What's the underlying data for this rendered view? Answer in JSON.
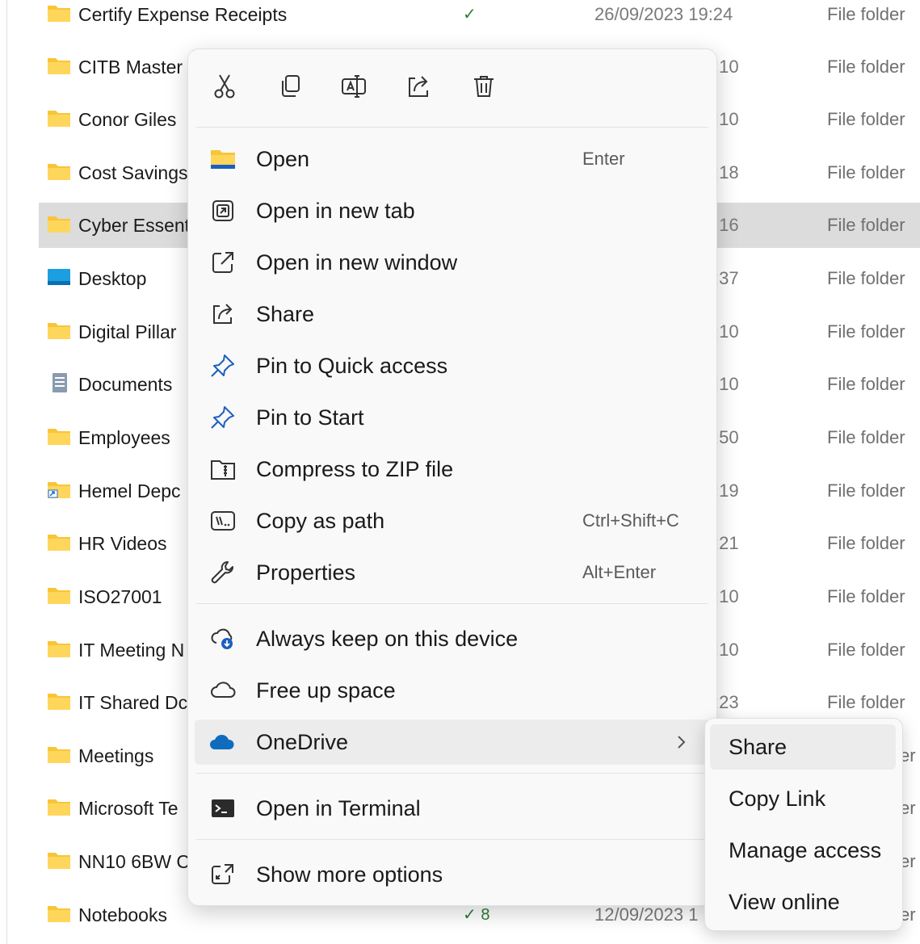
{
  "files": [
    {
      "name": "Certify Expense Receipts",
      "date": "26/09/2023 19:24",
      "type": "File folder",
      "icon": "folder-icon",
      "status": "synced-check"
    },
    {
      "name": "CITB Master",
      "time": ":10",
      "type": "File folder",
      "icon": "folder-icon"
    },
    {
      "name": "Conor Giles",
      "time": ":10",
      "type": "File folder",
      "icon": "folder-icon"
    },
    {
      "name": "Cost Savings",
      "time": ":18",
      "type": "File folder",
      "icon": "folder-icon"
    },
    {
      "name": "Cyber Essent",
      "time": ":16",
      "type": "File folder",
      "icon": "folder-icon",
      "selected": true
    },
    {
      "name": "Desktop",
      "time": ":37",
      "type": "File folder",
      "icon": "desktop-folder-icon"
    },
    {
      "name": "Digital Pillar",
      "time": ":10",
      "type": "File folder",
      "icon": "folder-icon"
    },
    {
      "name": "Documents",
      "time": ":10",
      "type": "File folder",
      "icon": "documents-folder-icon"
    },
    {
      "name": "Employees",
      "time": ":50",
      "type": "File folder",
      "icon": "folder-icon"
    },
    {
      "name": "Hemel Depc",
      "time": ":19",
      "type": "File folder",
      "icon": "shortcut-folder-icon"
    },
    {
      "name": "HR Videos",
      "time": ":21",
      "type": "File folder",
      "icon": "folder-icon"
    },
    {
      "name": "ISO27001",
      "time": ":10",
      "type": "File folder",
      "icon": "folder-icon"
    },
    {
      "name": "IT Meeting N",
      "time": ":10",
      "type": "File folder",
      "icon": "folder-icon"
    },
    {
      "name": "IT Shared Dc",
      "time": ":23",
      "type": "File folder",
      "icon": "folder-icon"
    },
    {
      "name": "Meetings",
      "typecut": "er",
      "icon": "folder-icon"
    },
    {
      "name": "Microsoft Te",
      "typecut": "er",
      "icon": "folder-icon"
    },
    {
      "name": "NN10 6BW C",
      "typecut": "er",
      "icon": "folder-icon"
    },
    {
      "name": "Notebooks",
      "date": "12/09/2023 1",
      "typecut": "er",
      "icon": "folder-icon",
      "status": "synced-shared"
    }
  ],
  "status_glyphs": {
    "synced-check": "✓",
    "synced-shared": "✓ 8"
  },
  "quick_actions": [
    {
      "name": "cut",
      "icon": "scissors-icon"
    },
    {
      "name": "copy",
      "icon": "copy-icon"
    },
    {
      "name": "rename",
      "icon": "rename-icon"
    },
    {
      "name": "share",
      "icon": "share-icon"
    },
    {
      "name": "delete",
      "icon": "trash-icon"
    }
  ],
  "menu": {
    "open": {
      "label": "Open",
      "shortcut": "Enter",
      "icon": "folder-open-icon"
    },
    "open_new_tab": {
      "label": "Open in new tab",
      "icon": "new-tab-icon"
    },
    "open_new_window": {
      "label": "Open in new window",
      "icon": "new-window-icon"
    },
    "share": {
      "label": "Share",
      "icon": "share-icon"
    },
    "pin_quick": {
      "label": "Pin to Quick access",
      "icon": "pin-icon"
    },
    "pin_start": {
      "label": "Pin to Start",
      "icon": "pin-icon"
    },
    "compress": {
      "label": "Compress to ZIP file",
      "icon": "zip-icon"
    },
    "copy_path": {
      "label": "Copy as path",
      "shortcut": "Ctrl+Shift+C",
      "icon": "copy-path-icon"
    },
    "properties": {
      "label": "Properties",
      "shortcut": "Alt+Enter",
      "icon": "wrench-icon"
    },
    "always_keep": {
      "label": "Always keep on this device",
      "icon": "cloud-download-icon"
    },
    "free_up": {
      "label": "Free up space",
      "icon": "cloud-icon"
    },
    "onedrive": {
      "label": "OneDrive",
      "icon": "onedrive-cloud-icon"
    },
    "terminal": {
      "label": "Open in Terminal",
      "icon": "terminal-icon"
    },
    "more_options": {
      "label": "Show more options",
      "icon": "more-options-icon"
    }
  },
  "submenu": {
    "share": "Share",
    "copy_link": "Copy Link",
    "manage_access": "Manage access",
    "view_online": "View online"
  },
  "colors": {
    "folder": "#f8c537",
    "onedrive": "#0f6cbd",
    "selected_row": "#dcdcdc",
    "accent": "#0f6cbd"
  }
}
